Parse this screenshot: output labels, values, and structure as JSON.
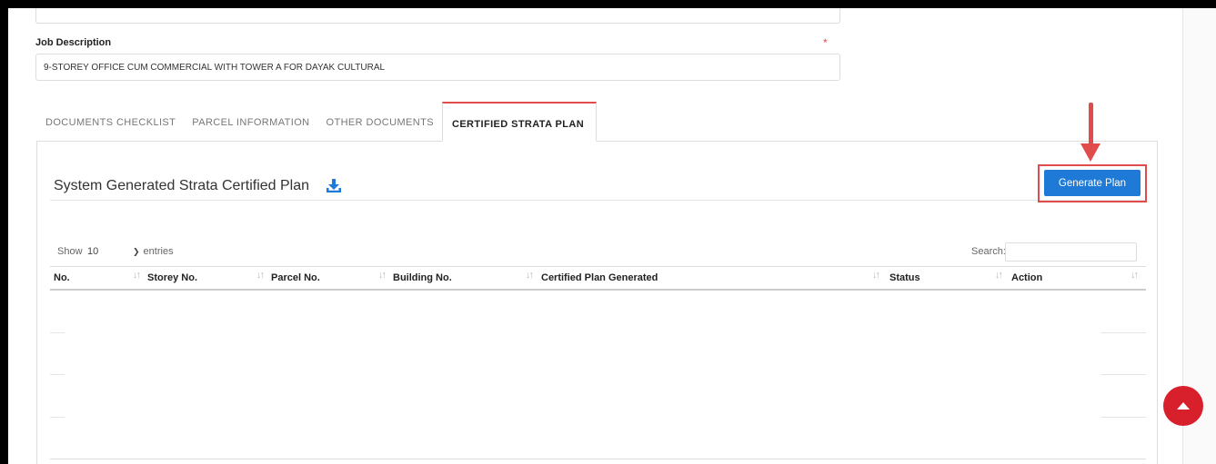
{
  "form": {
    "job_description_label": "Job Description",
    "required_marker": "*",
    "job_description_value": "9-STOREY OFFICE CUM COMMERCIAL WITH TOWER A FOR DAYAK  CULTURAL"
  },
  "tabs": [
    {
      "label": "DOCUMENTS CHECKLIST",
      "active": false
    },
    {
      "label": "PARCEL INFORMATION",
      "active": false
    },
    {
      "label": "OTHER DOCUMENTS",
      "active": false
    },
    {
      "label": "CERTIFIED STRATA PLAN",
      "active": true
    }
  ],
  "section": {
    "title": "System Generated Strata Certified Plan",
    "download_icon": "download-icon",
    "generate_button_label": "Generate Plan",
    "highlight_color": "#e04b4b",
    "button_color": "#1e7ad6"
  },
  "table_controls": {
    "show_label": "Show",
    "page_length": "10",
    "entries_label": "entries",
    "search_label": "Search:",
    "search_value": ""
  },
  "table": {
    "columns": [
      "No.",
      "Storey No.",
      "Parcel No.",
      "Building No.",
      "Certified Plan Generated",
      "Status",
      "Action"
    ],
    "rows": []
  },
  "scroll_top_icon": "arrow-up-icon",
  "scroll_top_color": "#d8202c"
}
